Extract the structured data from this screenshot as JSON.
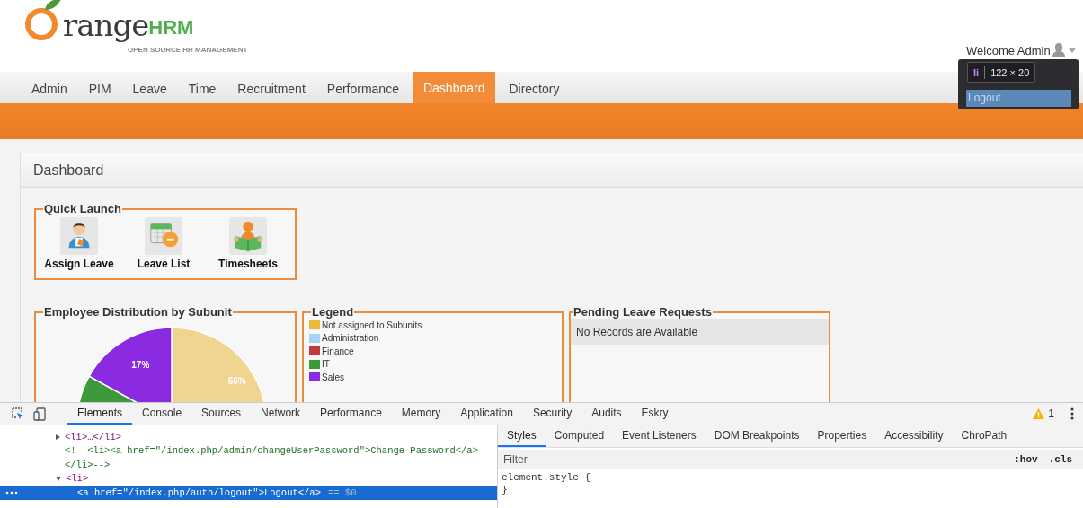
{
  "header": {
    "logo_word": "range",
    "logo_brand": "HRM",
    "tagline": "OPEN SOURCE HR MANAGEMENT",
    "welcome": "Welcome Admin"
  },
  "user_menu": {
    "items": [
      {
        "label": "Logout",
        "selected": true
      }
    ]
  },
  "inspector_tooltip": {
    "tag": "li",
    "size": "122 × 20"
  },
  "nav": [
    {
      "label": "Admin",
      "selected": false
    },
    {
      "label": "PIM",
      "selected": false
    },
    {
      "label": "Leave",
      "selected": false
    },
    {
      "label": "Time",
      "selected": false
    },
    {
      "label": "Recruitment",
      "selected": false
    },
    {
      "label": "Performance",
      "selected": false
    },
    {
      "label": "Dashboard",
      "selected": true
    },
    {
      "label": "Directory",
      "selected": false
    }
  ],
  "page": {
    "title": "Dashboard"
  },
  "quick_launch": {
    "title": "Quick Launch",
    "items": [
      {
        "label": "Assign Leave",
        "kind": "assign"
      },
      {
        "label": "Leave List",
        "kind": "calendar"
      },
      {
        "label": "Timesheets",
        "kind": "reader"
      }
    ]
  },
  "distribution": {
    "title": "Employee Distribution by Subunit",
    "slices": [
      {
        "color": "#f0d591",
        "label": "66%"
      },
      {
        "color": "#3c9a3c"
      },
      {
        "color": "#8a2be2",
        "label": "17%"
      }
    ]
  },
  "legend": {
    "title": "Legend",
    "items": [
      {
        "label": "Not assigned to Subunits",
        "color": "#e8b93a"
      },
      {
        "label": "Administration",
        "color": "#a9d3f2"
      },
      {
        "label": "Finance",
        "color": "#c0393b"
      },
      {
        "label": "IT",
        "color": "#3a9a3a"
      },
      {
        "label": "Sales",
        "color": "#8a2be2"
      }
    ]
  },
  "pending": {
    "title": "Pending Leave Requests",
    "message": "No Records are Available"
  },
  "devtools": {
    "tabs": [
      {
        "label": "Elements",
        "selected": true
      },
      {
        "label": "Console",
        "selected": false
      },
      {
        "label": "Sources",
        "selected": false
      },
      {
        "label": "Network",
        "selected": false
      },
      {
        "label": "Performance",
        "selected": false
      },
      {
        "label": "Memory",
        "selected": false
      },
      {
        "label": "Application",
        "selected": false
      },
      {
        "label": "Security",
        "selected": false
      },
      {
        "label": "Audits",
        "selected": false
      },
      {
        "label": "Eskry",
        "selected": false
      }
    ],
    "warning_count": "1",
    "dom": [
      {
        "markup": "<li>…</li>",
        "kind": "element",
        "expanded": false,
        "selected": false
      },
      {
        "markup": "<!--<li><a href=\"/index.php/admin/changeUserPassword\">Change Password</a>",
        "kind": "comment",
        "selected": false
      },
      {
        "markup": "</li>-->",
        "kind": "comment",
        "selected": false
      },
      {
        "markup": "<li>",
        "kind": "element",
        "expanded": true,
        "selected": false,
        "children": [
          {
            "markup": "<a href=\"/index.php/auth/logout\">Logout</a>",
            "kind": "element",
            "selected": true,
            "suffix": "== $0"
          }
        ]
      }
    ],
    "side_tabs": [
      {
        "label": "Styles",
        "selected": true
      },
      {
        "label": "Computed",
        "selected": false
      },
      {
        "label": "Event Listeners",
        "selected": false
      },
      {
        "label": "DOM Breakpoints",
        "selected": false
      },
      {
        "label": "Properties",
        "selected": false
      },
      {
        "label": "Accessibility",
        "selected": false
      },
      {
        "label": "ChroPath",
        "selected": false
      }
    ],
    "filter": {
      "placeholder": "Filter"
    },
    "toggles": [
      ":hov",
      ".cls"
    ],
    "style_rule": [
      "element.style {",
      "}"
    ]
  }
}
